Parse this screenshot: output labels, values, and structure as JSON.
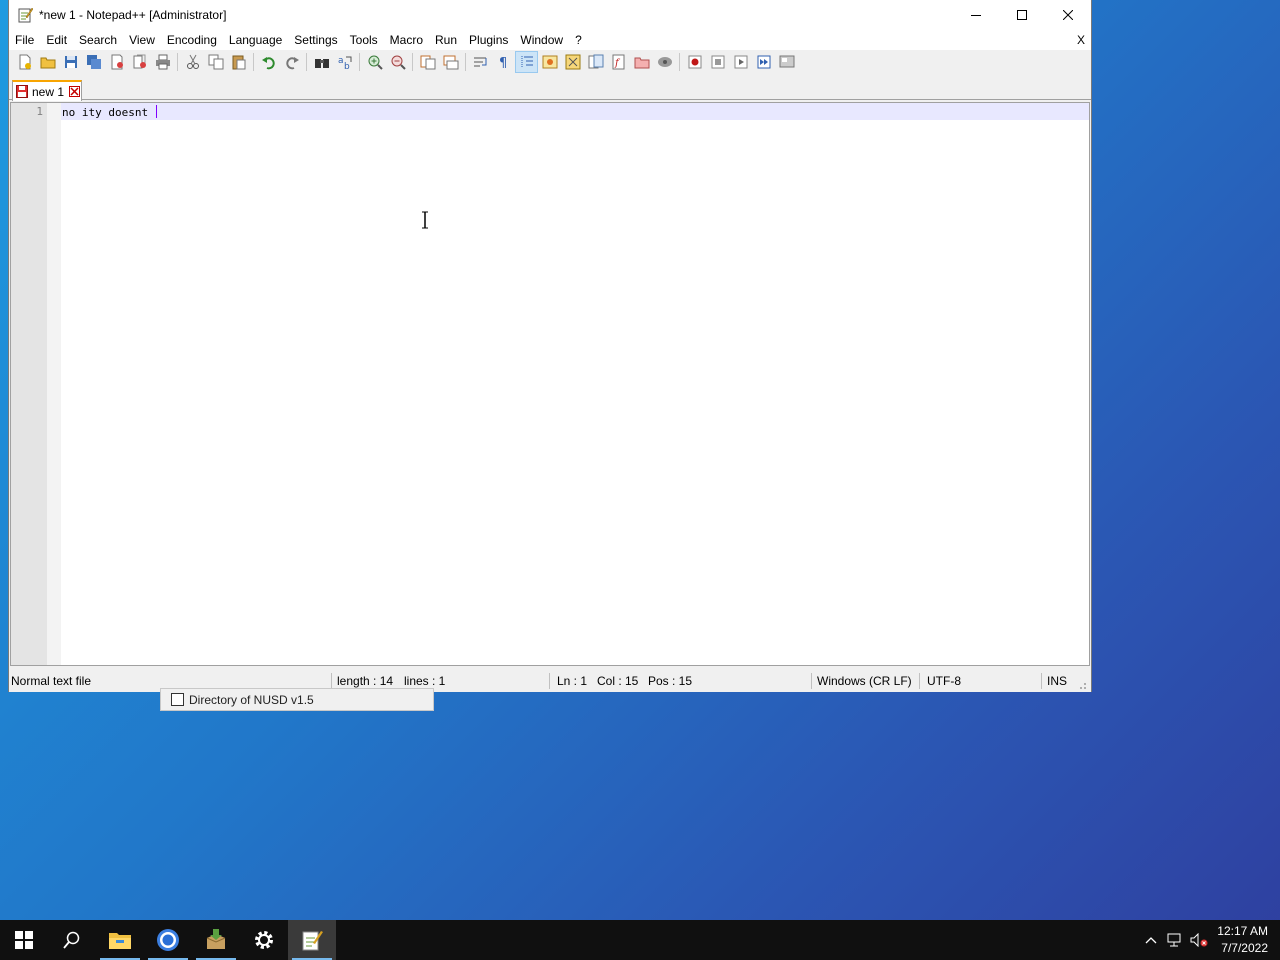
{
  "window": {
    "title": "*new 1 - Notepad++ [Administrator]",
    "icon": "notepadpp-icon",
    "controls": [
      "minimize",
      "maximize",
      "close"
    ]
  },
  "menu": {
    "items": [
      "File",
      "Edit",
      "Search",
      "View",
      "Encoding",
      "Language",
      "Settings",
      "Tools",
      "Macro",
      "Run",
      "Plugins",
      "Window",
      "?"
    ],
    "close_doc": "X"
  },
  "toolbar": {
    "buttons": [
      "new",
      "open",
      "save",
      "save-all",
      "close",
      "close-all",
      "print",
      "cut",
      "copy",
      "paste",
      "undo",
      "redo",
      "find",
      "replace",
      "zoom-in",
      "zoom-out",
      "sync-vertical",
      "sync-horizontal",
      "word-wrap",
      "show-all-chars",
      "indent-guide",
      "udl",
      "doc-map",
      "doc-list",
      "function-list",
      "folder-workspace",
      "monitoring",
      "record-macro",
      "stop-record",
      "playback",
      "run-multiple",
      "save-macro"
    ]
  },
  "tab": {
    "label": "new 1",
    "modified": true
  },
  "editor": {
    "line_number": "1",
    "content": "no ity doesnt "
  },
  "status": {
    "file_type": "Normal text file",
    "length": "length : 14",
    "lines": "lines : 1",
    "ln": "Ln : 1",
    "col": "Col : 15",
    "pos": "Pos : 15",
    "eol": "Windows (CR LF)",
    "encoding": "UTF-8",
    "mode": "INS"
  },
  "background_panel": {
    "label": "Directory of NUSD v1.5",
    "checked": false
  },
  "taskbar": {
    "apps": [
      "start",
      "search",
      "file-explorer",
      "chrome",
      "installer",
      "settings",
      "notepadpp"
    ],
    "time": "12:17 AM",
    "date": "7/7/2022"
  },
  "colors": {
    "tab_accent": "#f8a400",
    "current_line": "#e8e8ff",
    "caret": "#8000ff",
    "taskbar": "#101010"
  }
}
